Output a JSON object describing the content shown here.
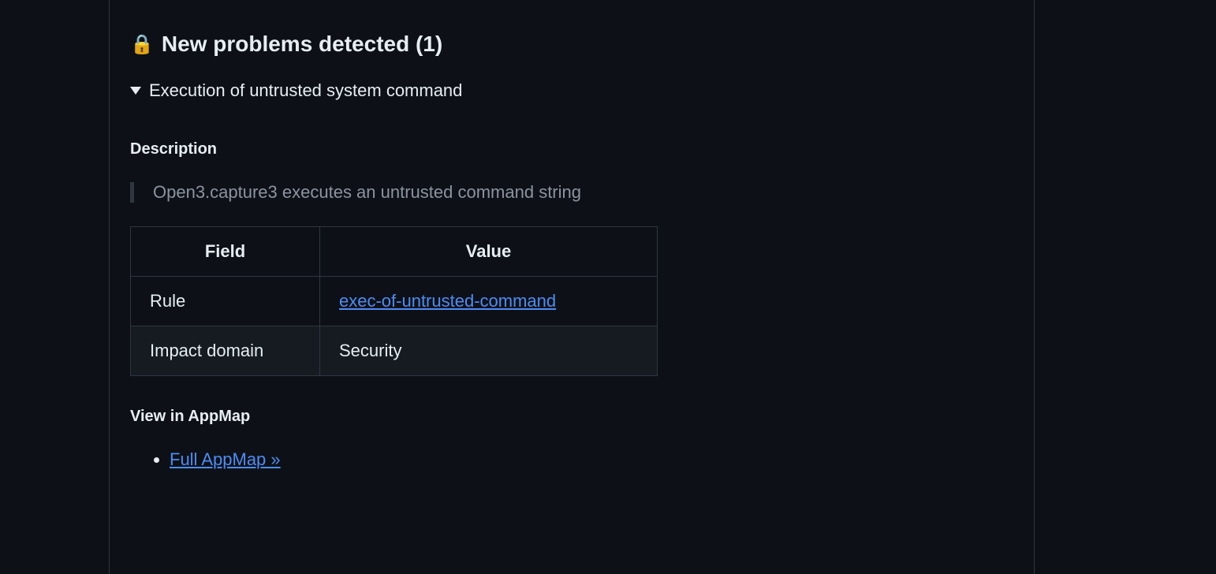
{
  "section": {
    "icon": "🔒",
    "title": "New problems detected (1)"
  },
  "problem": {
    "summary": "Execution of untrusted system command",
    "descriptionLabel": "Description",
    "descriptionText": "Open3.capture3 executes an untrusted command string",
    "table": {
      "headers": {
        "field": "Field",
        "value": "Value"
      },
      "rows": [
        {
          "field": "Rule",
          "value": "exec-of-untrusted-command",
          "isLink": true
        },
        {
          "field": "Impact domain",
          "value": "Security",
          "isLink": false
        }
      ]
    },
    "viewLabel": "View in AppMap",
    "viewLinks": [
      {
        "label": "Full AppMap »"
      }
    ]
  }
}
